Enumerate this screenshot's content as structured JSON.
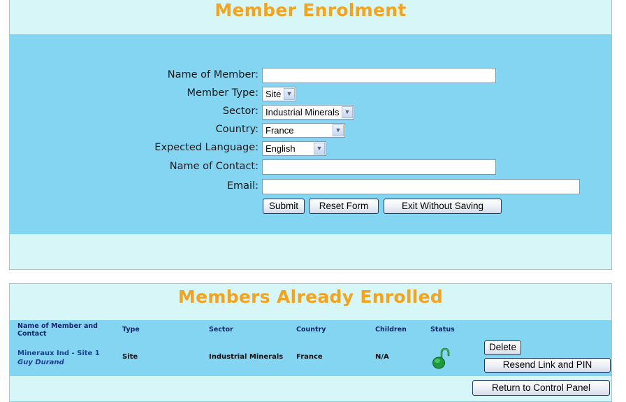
{
  "enrolment": {
    "title": "Member Enrolment",
    "fields": {
      "member_name": {
        "label": "Name of Member:",
        "value": ""
      },
      "member_type": {
        "label": "Member Type:",
        "value": "Site"
      },
      "sector": {
        "label": "Sector:",
        "value": "Industrial Minerals"
      },
      "country": {
        "label": "Country:",
        "value": "France"
      },
      "language": {
        "label": "Expected Language:",
        "value": "English"
      },
      "contact_name": {
        "label": "Name of Contact:",
        "value": ""
      },
      "email": {
        "label": "Email:",
        "value": ""
      }
    },
    "buttons": {
      "submit": "Submit",
      "reset": "Reset Form",
      "exit": "Exit Without Saving"
    }
  },
  "enrolled": {
    "title": "Members Already Enrolled",
    "columns": {
      "name": "Name of Member and Contact",
      "type": "Type",
      "sector": "Sector",
      "country": "Country",
      "children": "Children",
      "status": "Status"
    },
    "rows": [
      {
        "member": "Mineraux Ind - Site 1",
        "contact": "Guy Durand",
        "type": "Site",
        "sector": "Industrial Minerals",
        "country": "France",
        "children": "N/A",
        "status_icon": "unlocked-padlock-icon",
        "delete_label": "Delete",
        "resend_label": "Resend Link and PIN"
      }
    ],
    "return_label": "Return to Control Panel"
  },
  "colors": {
    "title": "#f5a31a",
    "band": "#83d5f2",
    "panel": "#d6f6f8",
    "header_text": "#12246b",
    "link_text": "#1c3f94",
    "status_green": "#1f9a3a"
  }
}
